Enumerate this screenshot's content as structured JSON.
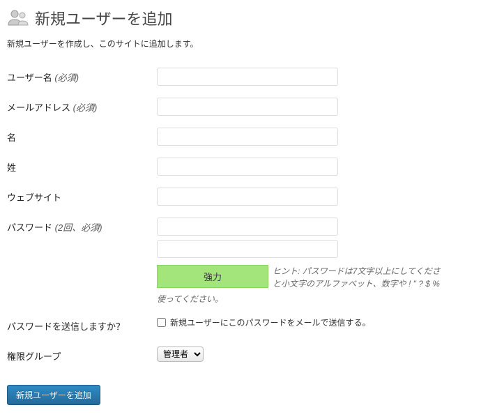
{
  "header": {
    "title": "新規ユーザーを追加",
    "description": "新規ユーザーを作成し、このサイトに追加します。"
  },
  "fields": {
    "username": {
      "label": "ユーザー名",
      "required": "(必須)",
      "value": ""
    },
    "email": {
      "label": "メールアドレス",
      "required": "(必須)",
      "value": ""
    },
    "firstname": {
      "label": "名",
      "value": ""
    },
    "lastname": {
      "label": "姓",
      "value": ""
    },
    "website": {
      "label": "ウェブサイト",
      "value": ""
    },
    "password": {
      "label": "パスワード",
      "required": "(2回、必須)",
      "value1": "",
      "value2": ""
    },
    "strength": {
      "label": "強力"
    },
    "hint": {
      "line1": "ヒント: パスワードは7文字以上にしてくださ",
      "line2": "と小文字のアルファベット、数字や ! \" ? $ %",
      "cont": "使ってください。"
    },
    "sendpw": {
      "label": "パスワードを送信しますか？",
      "checkbox_label": "新規ユーザーにこのパスワードをメールで送信する。"
    },
    "role": {
      "label": "権限グループ",
      "selected": "管理者"
    }
  },
  "submit": {
    "label": "新規ユーザーを追加"
  }
}
